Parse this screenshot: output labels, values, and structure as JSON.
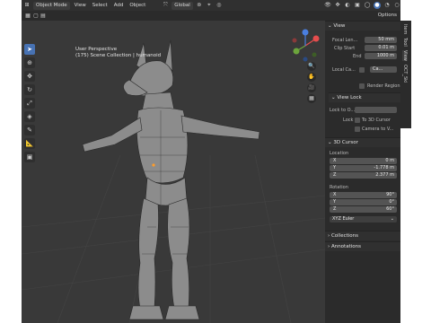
{
  "header": {
    "mode": "Object Mode",
    "menus": [
      "View",
      "Select",
      "Add",
      "Object"
    ],
    "transform": "Global",
    "options": "Options"
  },
  "viewport": {
    "perspective": "User Perspective",
    "collection": "(175) Scene Collection | humanoid"
  },
  "npanel": {
    "view": {
      "title": "View",
      "focal_label": "Focal Len...",
      "focal_value": "50 mm",
      "clip_start_label": "Clip Start",
      "clip_start_value": "0.01 m",
      "clip_end_label": "End",
      "clip_end_value": "1000 m",
      "local_camera_label": "Local Ca...",
      "local_camera_value": "Ca...",
      "render_region_label": "Render Region"
    },
    "view_lock": {
      "title": "View Lock",
      "lock_to_object_label": "Lock to O...",
      "lock_label": "Lock",
      "to_3d_cursor_label": "To 3D Cursor",
      "camera_to_view_label": "Camera to V..."
    },
    "cursor": {
      "title": "3D Cursor",
      "location_label": "Location",
      "x_label": "X",
      "x_value": "0 m",
      "y_label": "Y",
      "y_value": "-1.778 m",
      "z_label": "Z",
      "z_value": "2.377 m",
      "rotation_label": "Rotation",
      "rx_label": "X",
      "rx_value": "90°",
      "ry_label": "Y",
      "ry_value": "0°",
      "rz_label": "Z",
      "rz_value": "60°",
      "rotation_mode": "XYZ Euler"
    },
    "collections": "Collections",
    "annotations": "Annotations"
  },
  "tabs": [
    "Item",
    "Tool",
    "View",
    "OCT_Ski"
  ],
  "colors": {
    "accent": "#4772b3",
    "viewport_bg": "#393939",
    "panel_bg": "#2b2b2b"
  }
}
